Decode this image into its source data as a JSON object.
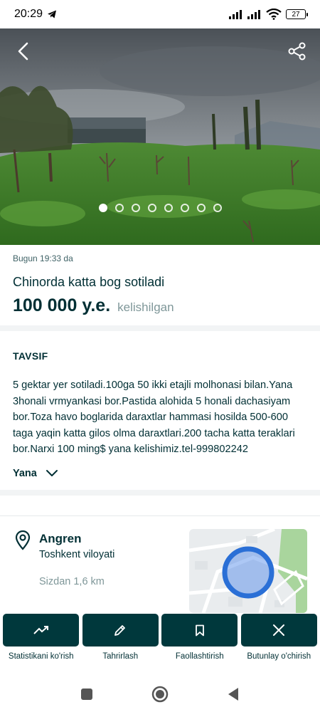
{
  "status": {
    "time": "20:29",
    "battery": "27"
  },
  "listing": {
    "posted": "Bugun 19:33 da",
    "title": "Chinorda katta bog sotiladi",
    "price": "100 000 y.e.",
    "negotiable": "kelishilgan",
    "photos": {
      "count": 8,
      "active_index": 0
    }
  },
  "description": {
    "heading": "TAVSIF",
    "text": "5 gektar yer sotiladi.100ga 50 ikki etajli molhonasi bilan.Yana 3honali vrmyankasi bor.Pastida alohida 5 honali dachasiyam bor.Toza havo boglarida daraxtlar hammasi hosilda 500-600 taga yaqin katta gilos olma daraxtlari.200 tacha katta teraklari bor.Narxi 100 ming$ yana kelishimiz.tel-999802242",
    "more_label": "Yana"
  },
  "location": {
    "city": "Angren",
    "region": "Toshkent viloyati",
    "distance": "Sizdan 1,6 km"
  },
  "actions": [
    {
      "label": "Statistikani ko'rish",
      "icon": "chart-trend-icon"
    },
    {
      "label": "Tahrirlash",
      "icon": "pencil-icon"
    },
    {
      "label": "Faollashtirish",
      "icon": "bookmark-icon"
    },
    {
      "label": "Butunlay o'chirish",
      "icon": "close-icon"
    }
  ],
  "colors": {
    "primary": "#002f34",
    "button_bg": "#00383c",
    "muted": "#7f9799",
    "map_ring": "#2a6fd6"
  }
}
